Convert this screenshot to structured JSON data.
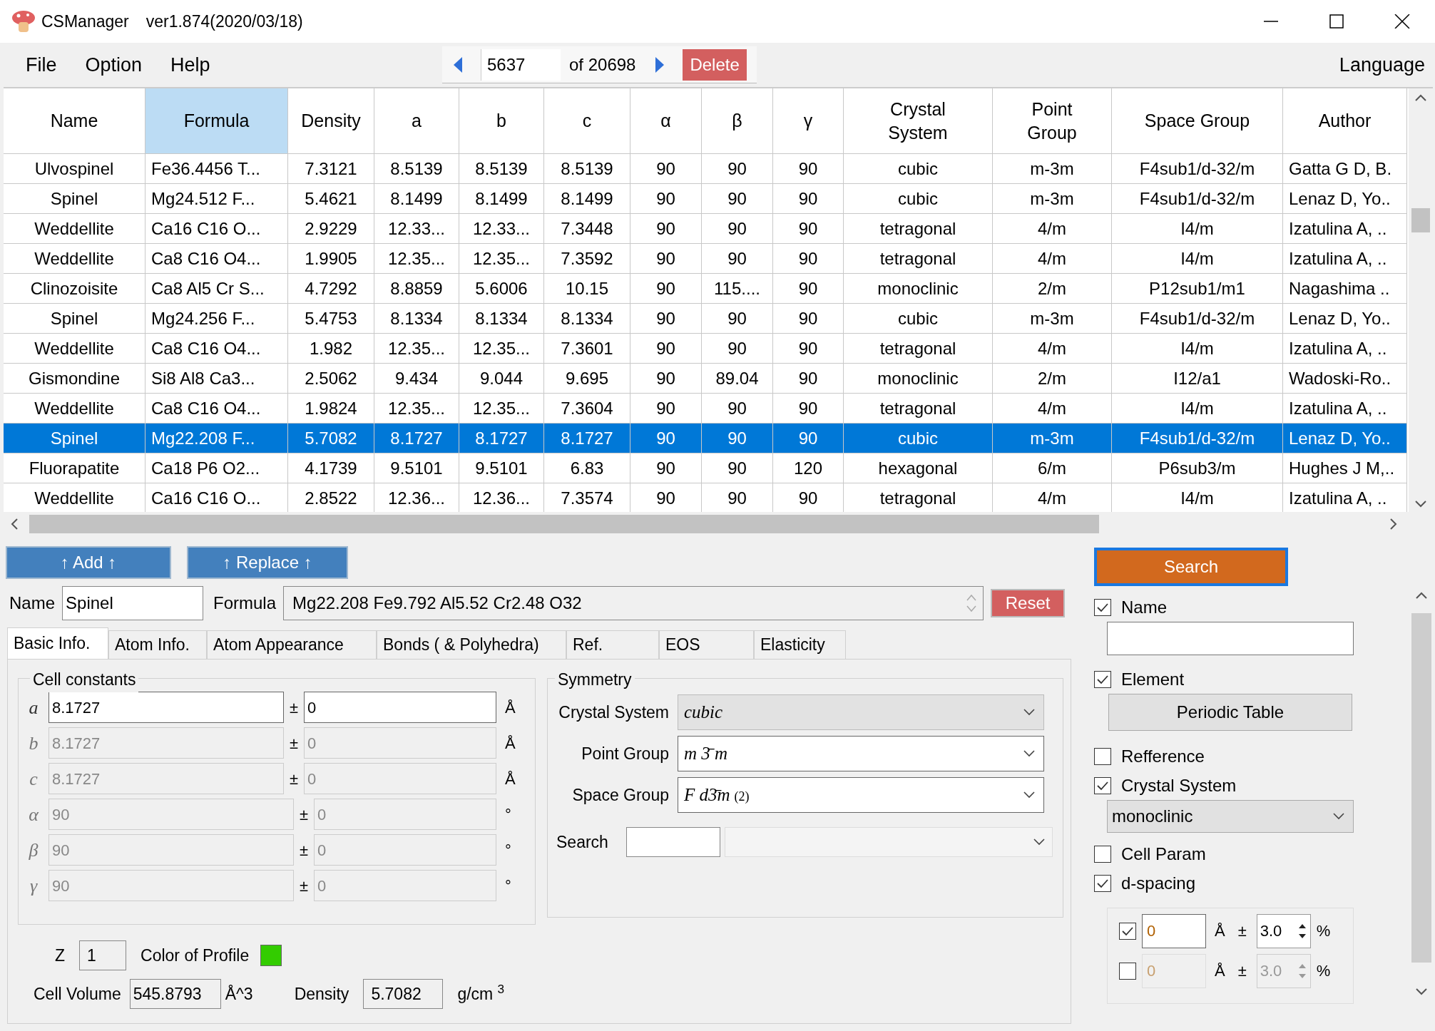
{
  "window": {
    "title": "CSManager",
    "version": "ver1.874(2020/03/18)"
  },
  "menu": [
    {
      "label": "File"
    },
    {
      "label": "Option"
    },
    {
      "label": "Help"
    }
  ],
  "navigator": {
    "current": "5637",
    "total": "of 20698",
    "delete": "Delete"
  },
  "language": "Language",
  "table": {
    "columns": [
      {
        "label": "Name",
        "selected": false
      },
      {
        "label": "Formula",
        "selected": true
      },
      {
        "label": "Density",
        "selected": false
      },
      {
        "label": "a",
        "selected": false
      },
      {
        "label": "b",
        "selected": false
      },
      {
        "label": "c",
        "selected": false
      },
      {
        "label": "α",
        "selected": false
      },
      {
        "label": "β",
        "selected": false
      },
      {
        "label": "γ",
        "selected": false
      },
      {
        "label": "Crystal System",
        "selected": false
      },
      {
        "label": "Point Group",
        "selected": false
      },
      {
        "label": "Space Group",
        "selected": false
      },
      {
        "label": "Author",
        "selected": false
      }
    ],
    "rows": [
      {
        "selected": false,
        "cells": [
          "Ulvospinel",
          "Fe36.4456 T...",
          "7.3121",
          "8.5139",
          "8.5139",
          "8.5139",
          "90",
          "90",
          "90",
          "cubic",
          "m-3m",
          "F4sub1/d-32/m",
          "Gatta G D, B."
        ]
      },
      {
        "selected": false,
        "cells": [
          "Spinel",
          "Mg24.512 F...",
          "5.4621",
          "8.1499",
          "8.1499",
          "8.1499",
          "90",
          "90",
          "90",
          "cubic",
          "m-3m",
          "F4sub1/d-32/m",
          "Lenaz D, Yo.."
        ]
      },
      {
        "selected": false,
        "cells": [
          "Weddellite",
          "Ca16 C16 O...",
          "2.9229",
          "12.33...",
          "12.33...",
          "7.3448",
          "90",
          "90",
          "90",
          "tetragonal",
          "4/m",
          "I4/m",
          "Izatulina A, .."
        ]
      },
      {
        "selected": false,
        "cells": [
          "Weddellite",
          "Ca8 C16 O4...",
          "1.9905",
          "12.35...",
          "12.35...",
          "7.3592",
          "90",
          "90",
          "90",
          "tetragonal",
          "4/m",
          "I4/m",
          "Izatulina A, .."
        ]
      },
      {
        "selected": false,
        "cells": [
          "Clinozoisite",
          "Ca8 Al5 Cr S...",
          "4.7292",
          "8.8859",
          "5.6006",
          "10.15",
          "90",
          "115....",
          "90",
          "monoclinic",
          "2/m",
          "P12sub1/m1",
          "Nagashima .."
        ]
      },
      {
        "selected": false,
        "cells": [
          "Spinel",
          "Mg24.256 F...",
          "5.4753",
          "8.1334",
          "8.1334",
          "8.1334",
          "90",
          "90",
          "90",
          "cubic",
          "m-3m",
          "F4sub1/d-32/m",
          "Lenaz D, Yo.."
        ]
      },
      {
        "selected": false,
        "cells": [
          "Weddellite",
          "Ca8 C16 O4...",
          "1.982",
          "12.35...",
          "12.35...",
          "7.3601",
          "90",
          "90",
          "90",
          "tetragonal",
          "4/m",
          "I4/m",
          "Izatulina A, .."
        ]
      },
      {
        "selected": false,
        "cells": [
          "Gismondine",
          "Si8 Al8 Ca3...",
          "2.5062",
          "9.434",
          "9.044",
          "9.695",
          "90",
          "89.04",
          "90",
          "monoclinic",
          "2/m",
          "I12/a1",
          "Wadoski-Ro.."
        ]
      },
      {
        "selected": false,
        "cells": [
          "Weddellite",
          "Ca8 C16 O4...",
          "1.9824",
          "12.35...",
          "12.35...",
          "7.3604",
          "90",
          "90",
          "90",
          "tetragonal",
          "4/m",
          "I4/m",
          "Izatulina A, .."
        ]
      },
      {
        "selected": true,
        "cells": [
          "Spinel",
          "Mg22.208 F...",
          "5.7082",
          "8.1727",
          "8.1727",
          "8.1727",
          "90",
          "90",
          "90",
          "cubic",
          "m-3m",
          "F4sub1/d-32/m",
          "Lenaz D, Yo.."
        ]
      },
      {
        "selected": false,
        "cells": [
          "Fluorapatite",
          "Ca18 P6 O2...",
          "4.1739",
          "9.5101",
          "9.5101",
          "6.83",
          "90",
          "90",
          "120",
          "hexagonal",
          "6/m",
          "P6sub3/m",
          "Hughes J M,.."
        ]
      },
      {
        "selected": false,
        "cells": [
          "Weddellite",
          "Ca16 C16 O...",
          "2.8522",
          "12.36...",
          "12.36...",
          "7.3574",
          "90",
          "90",
          "90",
          "tetragonal",
          "4/m",
          "I4/m",
          "Izatulina A, .."
        ]
      }
    ]
  },
  "actions": [
    "↑ Add ↑",
    "↑ Replace ↑"
  ],
  "record": {
    "name_label": "Name",
    "name": "Spinel",
    "formula_label": "Formula",
    "formula": "Mg22.208 Fe9.792 Al5.52 Cr2.48 O32",
    "reset": "Reset"
  },
  "tabs": [
    {
      "label": "Basic Info.",
      "selected": true
    },
    {
      "label": "Atom Info.",
      "selected": false
    },
    {
      "label": "Atom Appearance",
      "selected": false
    },
    {
      "label": "Bonds ( & Polyhedra)",
      "selected": false
    },
    {
      "label": "Ref.",
      "selected": false
    },
    {
      "label": "EOS",
      "selected": false
    },
    {
      "label": "Elasticity",
      "selected": false
    }
  ],
  "cell_constants": {
    "title": "Cell constants",
    "rows": [
      {
        "symbol": "a",
        "value": "8.1727",
        "pm": "±",
        "error": "0",
        "unit": "Å",
        "disabled": false
      },
      {
        "symbol": "b",
        "value": "8.1727",
        "pm": "±",
        "error": "0",
        "unit": "Å",
        "disabled": true
      },
      {
        "symbol": "c",
        "value": "8.1727",
        "pm": "±",
        "error": "0",
        "unit": "Å",
        "disabled": true
      },
      {
        "symbol": "α",
        "value": "90",
        "pm": "±",
        "error": "0",
        "unit": "°",
        "disabled": true
      },
      {
        "symbol": "β",
        "value": "90",
        "pm": "±",
        "error": "0",
        "unit": "°",
        "disabled": true
      },
      {
        "symbol": "γ",
        "value": "90",
        "pm": "±",
        "error": "0",
        "unit": "°",
        "disabled": true
      }
    ]
  },
  "symmetry": {
    "title": "Symmetry",
    "fields": [
      {
        "label": "Crystal System",
        "value": "cubic",
        "disabled": true
      },
      {
        "label": "Point Group",
        "value": "m 3̄ m",
        "disabled": false
      },
      {
        "label": "Space Group",
        "value": "F d3̄m",
        "setting": "(2)",
        "disabled": false
      }
    ],
    "search_label": "Search"
  },
  "z": {
    "label": "Z",
    "value": "1"
  },
  "profile": {
    "label": "Color of Profile",
    "color": "#33cc00"
  },
  "cell_volume": {
    "label": "Cell Volume",
    "value": "545.8793",
    "unit": "Å^3"
  },
  "density": {
    "label": "Density",
    "value": "5.7082",
    "unit": "g/cm $^{3}$"
  },
  "search_panel": {
    "button": "Search",
    "items": [
      {
        "kind": "check",
        "label": "Name",
        "checked": true
      },
      {
        "kind": "field"
      },
      {
        "kind": "check",
        "label": "Element",
        "checked": true
      },
      {
        "kind": "button",
        "label": "Periodic Table"
      },
      {
        "kind": "check",
        "label": "Refference",
        "checked": false
      },
      {
        "kind": "check",
        "label": "Crystal System",
        "checked": true
      },
      {
        "kind": "select",
        "value": "monoclinic"
      },
      {
        "kind": "check",
        "label": "Cell Param",
        "checked": false
      },
      {
        "kind": "check",
        "label": "d-spacing",
        "checked": true
      }
    ],
    "d_rows": [
      {
        "checked": true,
        "value": "0",
        "unit": "Å",
        "pm": "±",
        "tolerance": "3.0",
        "percent": "%"
      },
      {
        "checked": false,
        "value": "0",
        "unit": "Å",
        "pm": "±",
        "tolerance": "3.0",
        "percent": "%"
      }
    ]
  }
}
